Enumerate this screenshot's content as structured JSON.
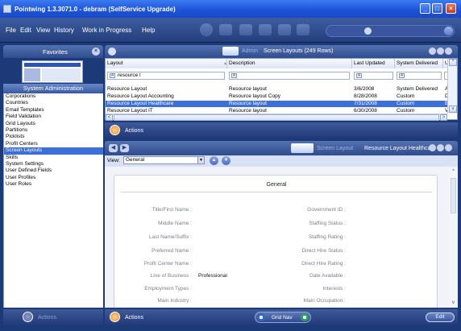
{
  "window": {
    "title": "Pointwing 1.3.3071.0 - debram (SelfService Upgrade)"
  },
  "menu": {
    "file": "File",
    "edit": "Edit",
    "view": "View",
    "history": "History",
    "wip": "Work in Progress",
    "help": "Help"
  },
  "favorites": {
    "title": "Favorites",
    "section": "System Administration"
  },
  "nav": {
    "items": [
      "Corporations",
      "Countries",
      "Email Templates",
      "Field Validation",
      "Grid Layouts",
      "Partitions",
      "Picklists",
      "Profit Centers",
      "Screen Layouts",
      "Skills",
      "System Settings",
      "User Defined Fields",
      "User Profiles",
      "User Roles"
    ],
    "selected_index": 8
  },
  "left_actions": {
    "label": "Actions"
  },
  "top_panel": {
    "admin_label": "Admin",
    "title": "Screen Layouts (249 Rows)"
  },
  "grid": {
    "columns": [
      "Layout",
      "Description",
      "Last Updated",
      "System Delivered",
      "U"
    ],
    "filter_value": "resource l",
    "rows": [
      [
        "Resource Layout",
        "Resource layout",
        "3/6/2008",
        "System Delivered",
        "A"
      ],
      [
        "Resource Layout Accounting",
        "Resource layout Copy",
        "8/28/2008",
        "Custom",
        "D"
      ],
      [
        "Resource Layout Healthcare",
        "Resource layout",
        "7/31/2008",
        "Custom",
        "B"
      ],
      [
        "Resource Layout IT",
        "Resource layout",
        "6/30/2008",
        "Custom",
        "V"
      ]
    ],
    "selected_row": 2
  },
  "actions_bar": {
    "label": "Actions"
  },
  "detail": {
    "screen_label": "Screen Layout",
    "record_name": "Resource Layout Healthcare",
    "view_label": "View:",
    "view_value": "General",
    "section_title": "General",
    "left_fields": [
      {
        "label": "Title/First Name",
        "value": ""
      },
      {
        "label": "Middle Name",
        "value": ""
      },
      {
        "label": "Last Name/Suffix",
        "value": ""
      },
      {
        "label": "Preferred Name",
        "value": ""
      },
      {
        "label": "Profit Center Name",
        "value": ""
      },
      {
        "label": "Line of Business",
        "value": "Professional"
      },
      {
        "label": "Employment Types",
        "value": ""
      },
      {
        "label": "Main Industry",
        "value": ""
      }
    ],
    "right_fields": [
      {
        "label": "Government ID",
        "value": ""
      },
      {
        "label": "Staffing Status",
        "value": ""
      },
      {
        "label": "Staffing Rating",
        "value": ""
      },
      {
        "label": "Direct Hire Status",
        "value": ""
      },
      {
        "label": "Direct Hire Rating",
        "value": ""
      },
      {
        "label": "Date Available",
        "value": ""
      },
      {
        "label": "Interests",
        "value": ""
      },
      {
        "label": "Main Occupation",
        "value": ""
      }
    ]
  },
  "bottom_bar": {
    "actions_label": "Actions",
    "grid_nav_label": "Grid Nav",
    "edit_label": "Edit"
  },
  "colors": {
    "selection": "#3d6fd8",
    "titlebar": "#1c52d8",
    "panel": "#2f4d8e"
  }
}
